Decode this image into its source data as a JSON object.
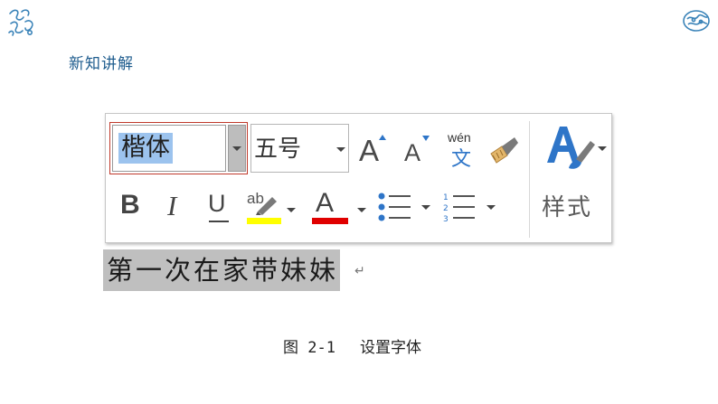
{
  "heading": "新知讲解",
  "toolbar": {
    "font_name": "楷体",
    "font_size": "五号",
    "grow_font": "A",
    "shrink_font": "A",
    "phonetic_guide_top": "wén",
    "phonetic_guide_bottom": "文",
    "bold": "B",
    "italic": "I",
    "underline": "U",
    "highlight_glyph": "ab",
    "font_color_glyph": "A",
    "styles_label": "样式",
    "highlight_color": "#ffff00",
    "font_color": "#e00000",
    "accent_color": "#2e75c8",
    "icons": [
      "format-painter-icon",
      "bullets-icon",
      "numbering-icon",
      "styles-icon"
    ]
  },
  "sample": {
    "text": "第一次在家带妹妹",
    "return_mark": "↵"
  },
  "caption": {
    "label": "图 2-1",
    "title": "设置字体"
  }
}
